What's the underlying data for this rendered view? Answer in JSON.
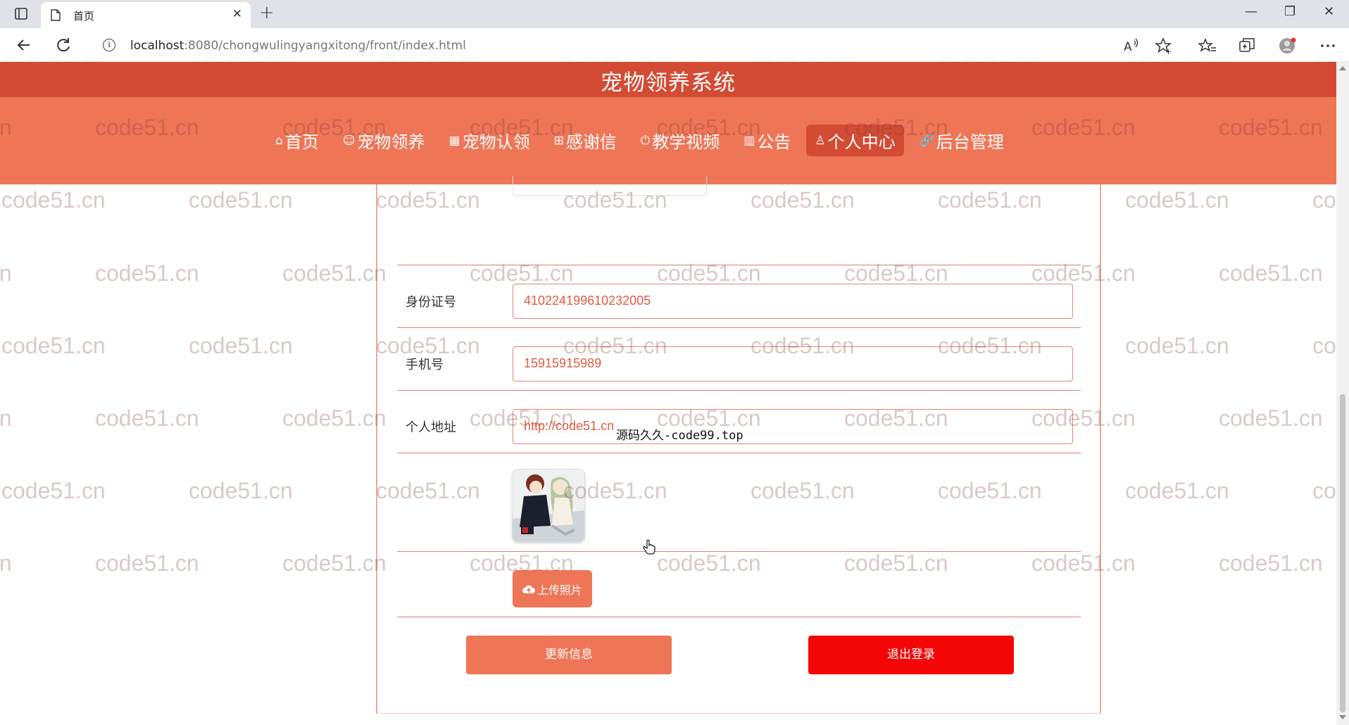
{
  "browser": {
    "tab_title": "首页",
    "url_host": "localhost",
    "url_rest": ":8080/chongwulingyangxitong/front/index.html"
  },
  "site": {
    "title": "宠物领养系统",
    "nav": [
      {
        "icon": "⌂",
        "label": "首页",
        "active": false
      },
      {
        "icon": "☺",
        "label": "宠物领养",
        "active": false
      },
      {
        "icon": "▦",
        "label": "宠物认领",
        "active": false
      },
      {
        "icon": "⊞",
        "label": "感谢信",
        "active": false
      },
      {
        "icon": "⏻",
        "label": "教学视频",
        "active": false
      },
      {
        "icon": "▥",
        "label": "公告",
        "active": false
      },
      {
        "icon": "♙",
        "label": "个人中心",
        "active": true
      },
      {
        "icon": "🔗",
        "label": "后台管理",
        "active": false
      }
    ]
  },
  "form": {
    "id_card": {
      "label": "身份证号",
      "value": "410224199610232005"
    },
    "phone": {
      "label": "手机号",
      "value": "15915915989"
    },
    "address": {
      "label": "个人地址",
      "value": "http://code51.cn"
    },
    "overlay_text": "源码久久-code99.top",
    "upload_label": "上传照片",
    "update_label": "更新信息",
    "logout_label": "退出登录"
  },
  "watermark": "code51.cn",
  "colors": {
    "title_bar": "#d44b34",
    "nav_bar": "#ef7557",
    "logout": "#f50606"
  }
}
